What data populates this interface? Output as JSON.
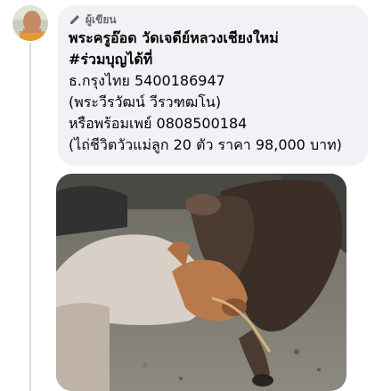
{
  "comment": {
    "author_badge": "ผู้เขียน",
    "author_badge_icon": "pencil-icon",
    "lines": [
      "พระครูอ๊อด วัดเจดีย์หลวงเชียงใหม่",
      "#ร่วมบุญได้ที่",
      "ธ.กรุงไทย 5400186947",
      "(พระวีรวัฒน์ วีรวฑฒโน)",
      "หรือพร้อมเพย์ 0808500184",
      "(ไถ่ชีวิตวัวแม่ลูก 20 ตัว ราคา 98,000 บาท)"
    ],
    "attachment": "photo-of-cow-and-calf"
  },
  "colors": {
    "bubble": "#f0f2f5",
    "text": "#050505",
    "muted": "#65676b",
    "thread_line": "#dadde1"
  }
}
